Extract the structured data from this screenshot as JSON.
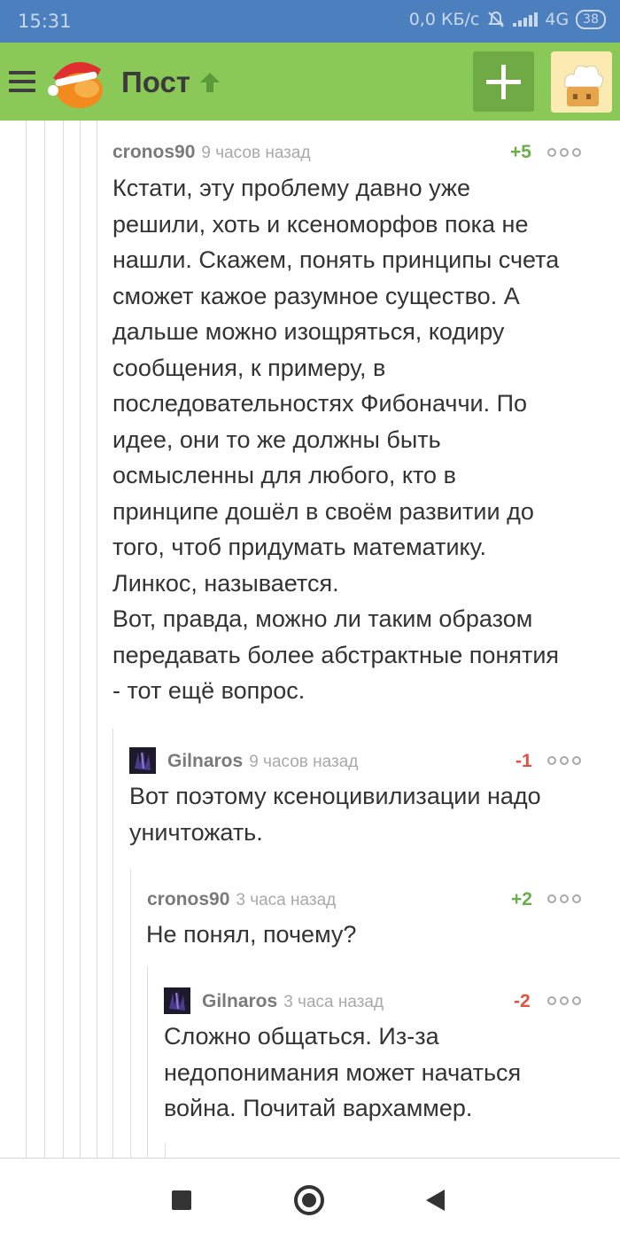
{
  "status_bar": {
    "time": "15:31",
    "network_speed": "0,0 КБ/с",
    "network_type": "4G",
    "battery": "38"
  },
  "header": {
    "title": "Пост",
    "colors": {
      "bar": "#8ac858",
      "add_button": "#6faa45"
    }
  },
  "comments": [
    {
      "author": "cronos90",
      "time": "9 часов назад",
      "rating": "+5",
      "text": "Кстати, эту проблему давно уже\nрешили, хоть и ксеноморфов пока не\nнашли. Скажем, понять принципы счета\nсможет кажое разумное существо. А\nдальше можно изощряться, кодиру\nсообщения, к примеру, в\nпоследовательностях Фибоначчи. По\nидее, они то же должны быть\nосмысленны для любого, кто в\nпринципе дошёл в своём развитии до\nтого, чтоб придумать математику.\nЛинкос, называется.\nВот, правда, можно ли таким образом\nпередавать более абстрактные понятия\n- тот ещё вопрос."
    },
    {
      "author": "Gilnaros",
      "time": "9 часов назад",
      "rating": "-1",
      "text": "Вот поэтому ксеноцивилизации надо\nуничтожать."
    },
    {
      "author": "cronos90",
      "time": "3 часа назад",
      "rating": "+2",
      "text": "Не понял, почему?"
    },
    {
      "author": "Gilnaros",
      "time": "3 часа назад",
      "rating": "-2",
      "text": "Сложно общаться. Из-за\nнедопонимания может начаться\nвойна. Почитай вархаммер."
    }
  ],
  "colors": {
    "positive": "#6aae4a",
    "negative": "#e0533e",
    "status_bar": "#4c7fbe"
  },
  "icons": [
    "hamburger-icon",
    "app-logo",
    "arrow-up-icon",
    "plus-icon",
    "more-icon",
    "nav-recents-icon",
    "nav-home-icon",
    "nav-back-icon"
  ]
}
